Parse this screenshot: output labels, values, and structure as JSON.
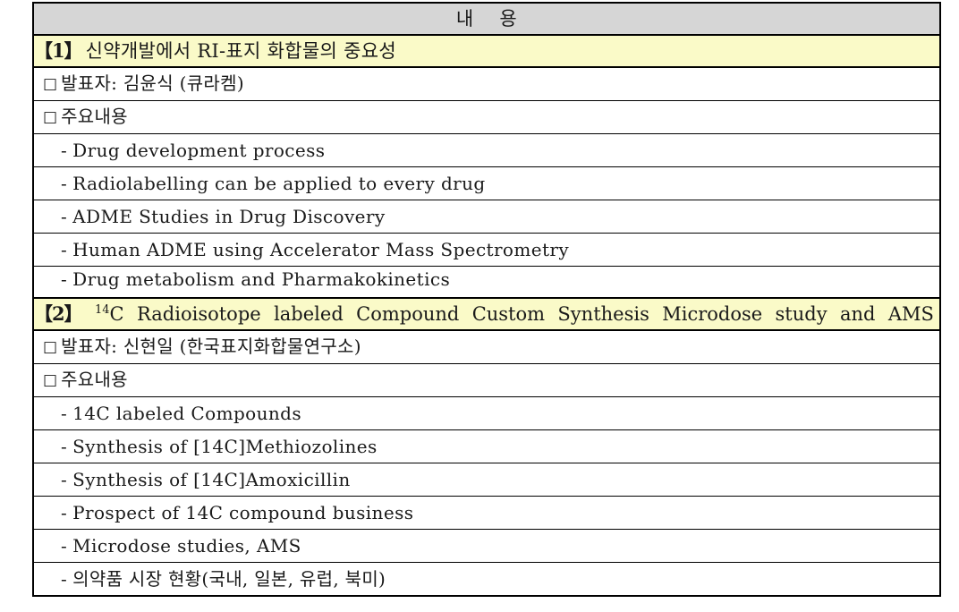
{
  "table": {
    "column_header": "내    용",
    "colors": {
      "header_bg": "#d6d6d6",
      "section_bg": "#fafac8",
      "border": "#000000",
      "text": "#1a1a1a"
    },
    "sections": [
      {
        "number_label": "【1】",
        "title": "신약개발에서 RI-표지 화합물의 중요성",
        "rows": [
          {
            "type": "checkbox",
            "text": "발표자: 김윤식 (큐라켐)"
          },
          {
            "type": "checkbox",
            "text": "주요내용"
          },
          {
            "type": "dash",
            "text": "Drug development process"
          },
          {
            "type": "dash",
            "text": "Radiolabelling can be applied to every drug"
          },
          {
            "type": "dash",
            "text": "ADME Studies in Drug Discovery"
          },
          {
            "type": "dash",
            "text": "Human ADME using Accelerator Mass Spectrometry"
          },
          {
            "type": "dash",
            "text": "Drug metabolism and Pharmakokinetics",
            "clipped": true
          }
        ]
      },
      {
        "number_label": "【2】",
        "title_words": [
          "C",
          "Radioisotope",
          "labeled",
          "Compound",
          "Custom",
          "Synthesis",
          "Microdose",
          "study",
          "and",
          "AMS"
        ],
        "title_superscript": "14",
        "title_plain": "【2】 14C Radioisotope labeled Compound Custom Synthesis Microdose study and AMS",
        "rows": [
          {
            "type": "checkbox",
            "text": "발표자: 신현일 (한국표지화합물연구소)"
          },
          {
            "type": "checkbox",
            "text": "주요내용"
          },
          {
            "type": "dash",
            "text": "14C labeled Compounds"
          },
          {
            "type": "dash",
            "text": "Synthesis of [14C]Methiozolines"
          },
          {
            "type": "dash",
            "text": "Synthesis of [14C]Amoxicillin"
          },
          {
            "type": "dash",
            "text": "Prospect of 14C compound business"
          },
          {
            "type": "dash",
            "text": "Microdose studies, AMS"
          },
          {
            "type": "dash",
            "text": "의약품 시장 현황(국내, 일본, 유럽, 북미)"
          }
        ]
      }
    ]
  },
  "glyphs": {
    "checkbox": "□",
    "dash": "-"
  }
}
